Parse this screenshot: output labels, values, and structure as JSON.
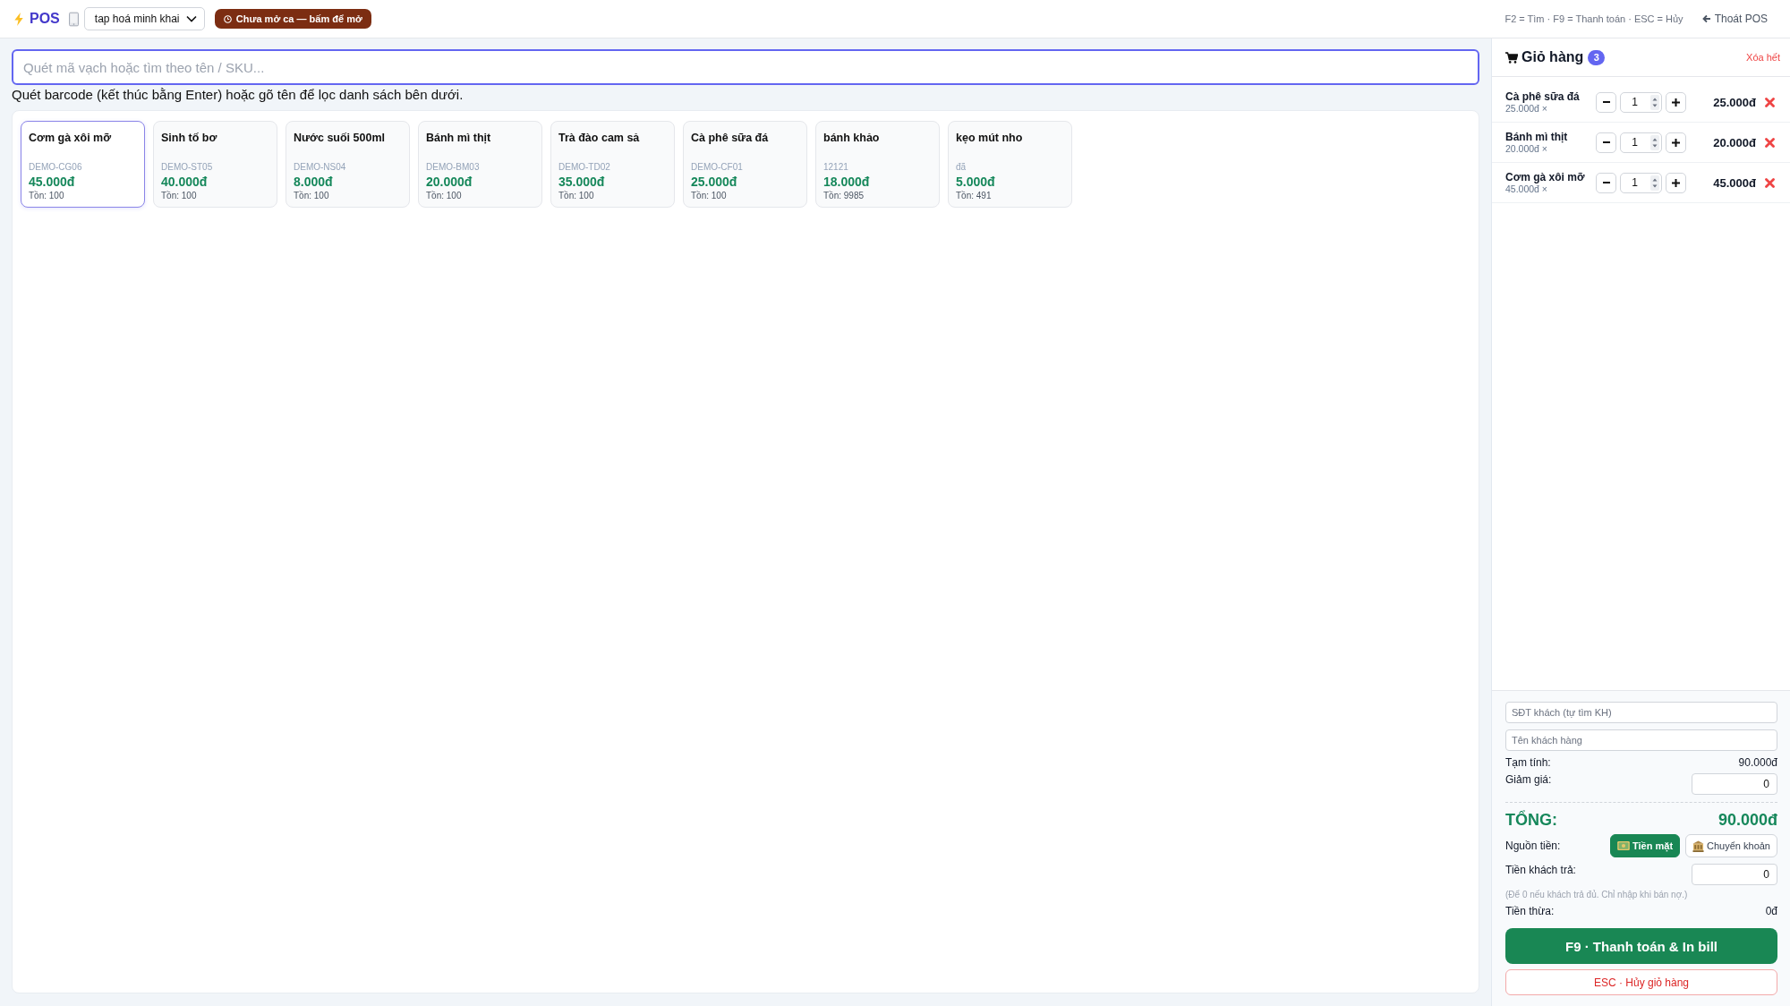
{
  "top_bar": {
    "app_name": "POS",
    "store_select": {
      "value": "tap hoá minh khai"
    },
    "shift_button": "Chưa mở ca — bấm để mở",
    "shortcuts_hint": "F2 = Tìm · F9 = Thanh toán · ESC = Hủy",
    "exit_link": "Thoát POS"
  },
  "search": {
    "placeholder": "Quét mã vạch hoặc tìm theo tên / SKU...",
    "hint": "Quét barcode (kết thúc bằng Enter) hoặc gõ tên để lọc danh sách bên dưới."
  },
  "products": [
    {
      "name": "Cơm gà xôi mỡ",
      "sku": "DEMO-CG06",
      "price": "45.000đ",
      "stock": "Tồn: 100",
      "selected": true
    },
    {
      "name": "Sinh tố bơ",
      "sku": "DEMO-ST05",
      "price": "40.000đ",
      "stock": "Tồn: 100",
      "selected": false
    },
    {
      "name": "Nước suối 500ml",
      "sku": "DEMO-NS04",
      "price": "8.000đ",
      "stock": "Tồn: 100",
      "selected": false
    },
    {
      "name": "Bánh mì thịt",
      "sku": "DEMO-BM03",
      "price": "20.000đ",
      "stock": "Tồn: 100",
      "selected": false
    },
    {
      "name": "Trà đào cam sả",
      "sku": "DEMO-TD02",
      "price": "35.000đ",
      "stock": "Tồn: 100",
      "selected": false
    },
    {
      "name": "Cà phê sữa đá",
      "sku": "DEMO-CF01",
      "price": "25.000đ",
      "stock": "Tồn: 100",
      "selected": false
    },
    {
      "name": "bánh khảo",
      "sku": "12121",
      "price": "18.000đ",
      "stock": "Tồn: 9985",
      "selected": false
    },
    {
      "name": "kẹo mút nho",
      "sku": "đã",
      "price": "5.000đ",
      "stock": "Tồn: 491",
      "selected": false
    }
  ],
  "cart": {
    "title": "Giỏ hàng",
    "count": "3",
    "clear_link": "Xóa hết",
    "items": [
      {
        "name": "Cà phê sữa đá",
        "unit_price": "25.000đ ×",
        "quantity": "1",
        "total": "25.000đ"
      },
      {
        "name": "Bánh mì thịt",
        "unit_price": "20.000đ ×",
        "quantity": "1",
        "total": "20.000đ"
      },
      {
        "name": "Cơm gà xôi mỡ",
        "unit_price": "45.000đ ×",
        "quantity": "1",
        "total": "45.000đ"
      }
    ],
    "customer_phone": {
      "placeholder": "SĐT khách (tự tìm KH)"
    },
    "customer_name": {
      "placeholder": "Tên khách hàng"
    },
    "subtotal": {
      "label": "Tạm tính:",
      "value": "90.000đ"
    },
    "discount": {
      "label": "Giảm giá:",
      "value": "0"
    },
    "total": {
      "label": "TỔNG:",
      "value": "90.000đ"
    },
    "payment_source": {
      "label": "Nguồn tiền:",
      "options": [
        {
          "label": "Tiền mặt",
          "kind": "cash",
          "selected": true
        },
        {
          "label": "Chuyển khoản",
          "kind": "transfer",
          "selected": false
        }
      ]
    },
    "customer_paid": {
      "label": "Tiền khách trả:",
      "value": "0"
    },
    "paid_note": "(Để 0 nếu khách trả đủ. Chỉ nhập khi bán nợ.)",
    "change": {
      "label": "Tiền thừa:",
      "value": "0đ"
    },
    "checkout_button": "F9 · Thanh toán & In bill",
    "cancel_button": "ESC · Hủy giỏ hàng"
  }
}
